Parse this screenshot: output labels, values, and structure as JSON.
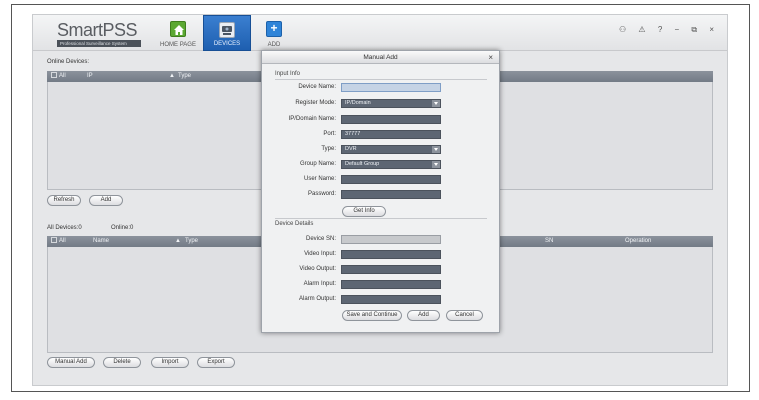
{
  "app": {
    "logo_name": "SmartPSS",
    "logo_tagline": "Professional Surveillance System",
    "nav": {
      "home_label": "HOME PAGE",
      "devices_label": "DEVICES",
      "add_label": "ADD"
    },
    "window_controls": "⚇ ⚠ ? − ⧉ ×"
  },
  "online_devices": {
    "section_label": "Online Devices:",
    "columns": {
      "all": "All",
      "ip": "IP",
      "type": "Type"
    },
    "buttons": {
      "refresh": "Refresh",
      "add": "Add"
    }
  },
  "all_devices": {
    "count_label": "All Devices:0",
    "online_label": "Online:0",
    "columns": {
      "all": "All",
      "name": "Name",
      "type": "Type",
      "sn": "SN",
      "operation": "Operation"
    },
    "buttons": {
      "manual_add": "Manual Add",
      "delete": "Delete",
      "import": "Import",
      "export": "Export"
    }
  },
  "dialog": {
    "title": "Manual Add",
    "close": "×",
    "input_info": {
      "section": "Input Info",
      "device_name_label": "Device Name:",
      "device_name_value": "",
      "register_mode_label": "Register Mode:",
      "register_mode_value": "IP/Domain",
      "ip_domain_label": "IP/Domain Name:",
      "ip_domain_value": "",
      "port_label": "Port:",
      "port_value": "37777",
      "type_label": "Type:",
      "type_value": "DVR",
      "group_label": "Group Name:",
      "group_value": "Default Group",
      "user_label": "User Name:",
      "user_value": "",
      "password_label": "Password:",
      "password_value": "",
      "get_info": "Get Info"
    },
    "device_details": {
      "section": "Device Details",
      "sn_label": "Device SN:",
      "video_input_label": "Video Input:",
      "video_output_label": "Video Output:",
      "alarm_input_label": "Alarm Input:",
      "alarm_output_label": "Alarm Output:"
    },
    "buttons": {
      "save_continue": "Save and Continue",
      "add": "Add",
      "cancel": "Cancel"
    }
  },
  "colors": {
    "accent": "#1e5fb0",
    "field": "#5d6673",
    "grid_header": "#7f8791",
    "home_icon": "#5ba832"
  }
}
